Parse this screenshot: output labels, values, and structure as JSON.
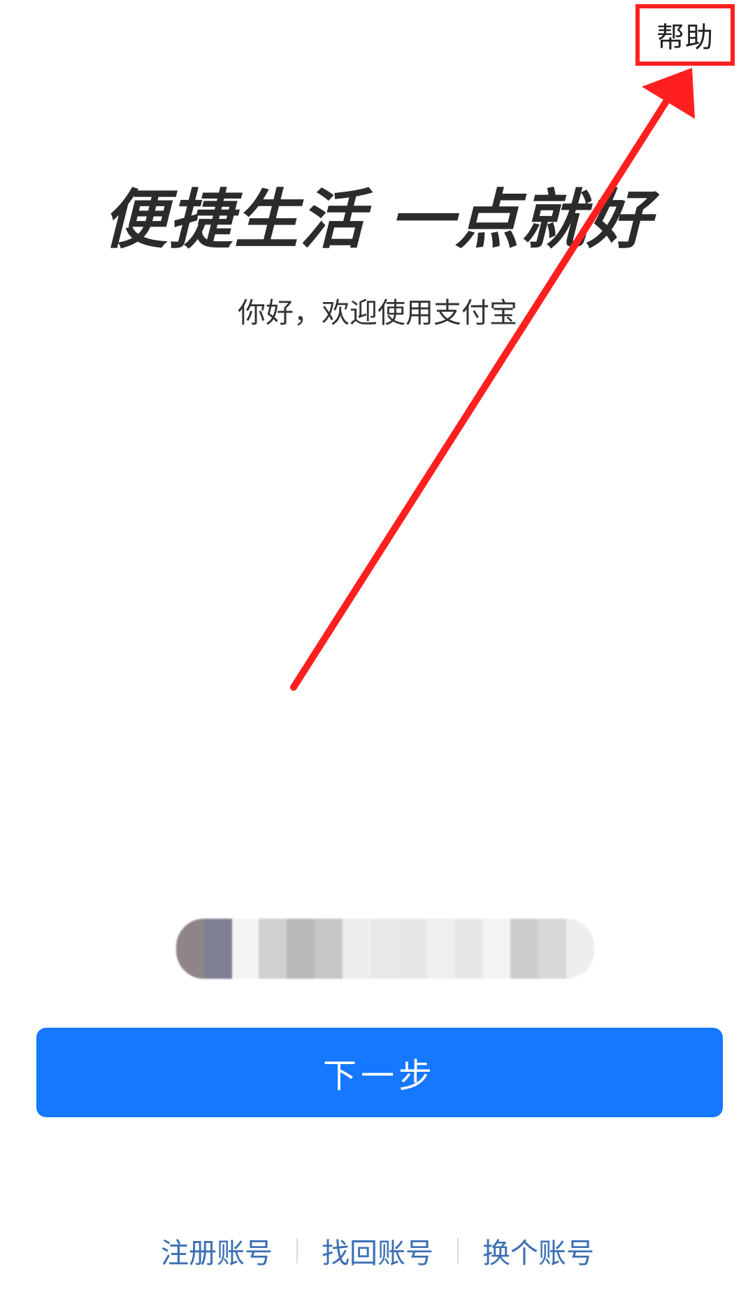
{
  "header": {
    "help_label": "帮助"
  },
  "main": {
    "headline": "便捷生活 一点就好",
    "subtitle": "你好，欢迎使用支付宝",
    "next_button_label": "下一步"
  },
  "footer": {
    "links": [
      "注册账号",
      "找回账号",
      "换个账号"
    ]
  },
  "colors": {
    "primary_button": "#1677ff",
    "link": "#3d6fb4",
    "annotation_red": "#ff1f1f"
  }
}
